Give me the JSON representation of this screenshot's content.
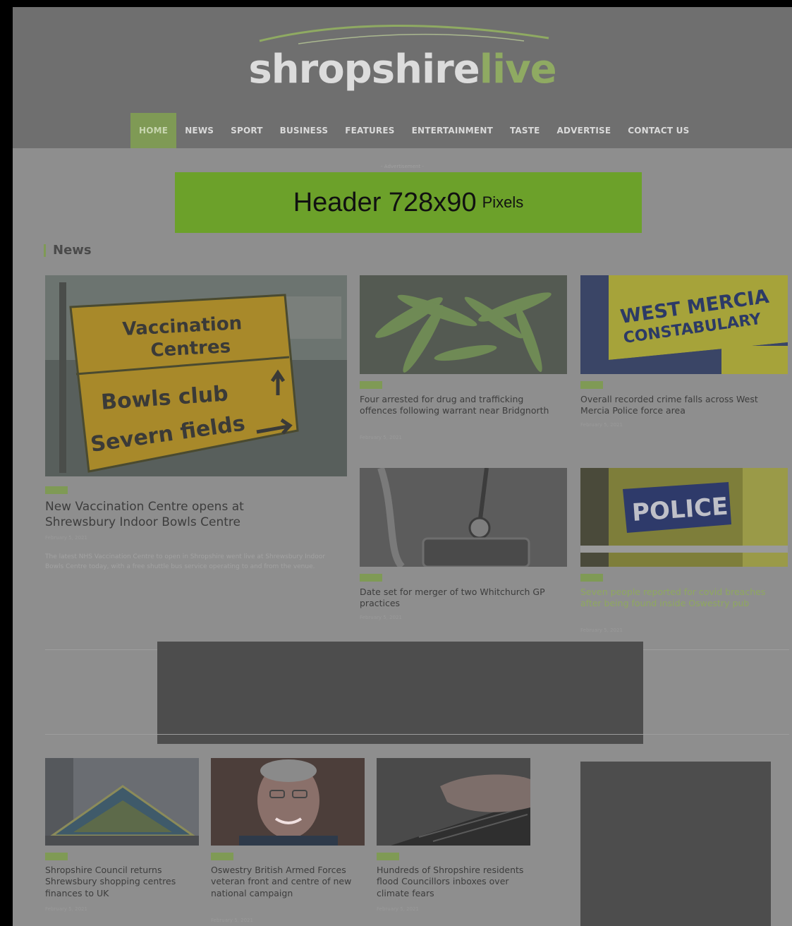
{
  "site": {
    "logo_main": "shropshire",
    "logo_accent": "live"
  },
  "nav": {
    "items": [
      "HOME",
      "NEWS",
      "SPORT",
      "BUSINESS",
      "FEATURES",
      "ENTERTAINMENT",
      "TASTE",
      "ADVERTISE",
      "CONTACT US"
    ],
    "active": "HOME"
  },
  "ad": {
    "label": "- Advertisement -",
    "banner_main": "Header 728x90",
    "banner_unit": "Pixels",
    "color": "#6ca12a"
  },
  "section": {
    "title": "News"
  },
  "featured": {
    "tag": "News",
    "sign": {
      "line1": "Vaccination",
      "line2": "Centres",
      "line3": "Bowls club",
      "line4": "Severn fields"
    },
    "headline": "New Vaccination Centre opens at Shrewsbury Indoor Bowls Centre",
    "date": "February 5, 2021",
    "excerpt": "The latest NHS Vaccination Centre to open in Shropshire went live at Shrewsbury Indoor Bowls Centre today, with a free shuttle bus service operating to and from the venue."
  },
  "grid": [
    {
      "tag": "News",
      "headline": "Four arrested for drug and trafficking offences following warrant near Bridgnorth",
      "date": "February 5, 2021"
    },
    {
      "tag": "News",
      "headline": "Overall recorded crime falls across West Mercia Police force area",
      "date": "February 5, 2021",
      "image_text": "WEST MERCIA CONSTABULARY"
    },
    {
      "tag": "News",
      "headline": "Date set for merger of two Whitchurch GP practices",
      "date": "February 5, 2021"
    },
    {
      "tag": "News",
      "headline": "Seven people reported for covid breaches after being found inside Oswestry pub",
      "date": "February 5, 2021",
      "image_text": "POLICE"
    }
  ],
  "bottom": [
    {
      "tag": "News",
      "headline": "Shropshire Council returns Shrewsbury shopping centres finances to UK",
      "date": "February 5, 2021"
    },
    {
      "tag": "News",
      "headline": "Oswestry British Armed Forces veteran front and centre of new national campaign",
      "date": "February 5, 2021"
    },
    {
      "tag": "News",
      "headline": "Hundreds of Shropshire residents flood Councillors inboxes over climate fears",
      "date": "February 5, 2021"
    }
  ],
  "colors": {
    "accent": "#7f9a55",
    "logo_accent": "#8faa62",
    "header_bg": "#6f6f6f"
  }
}
